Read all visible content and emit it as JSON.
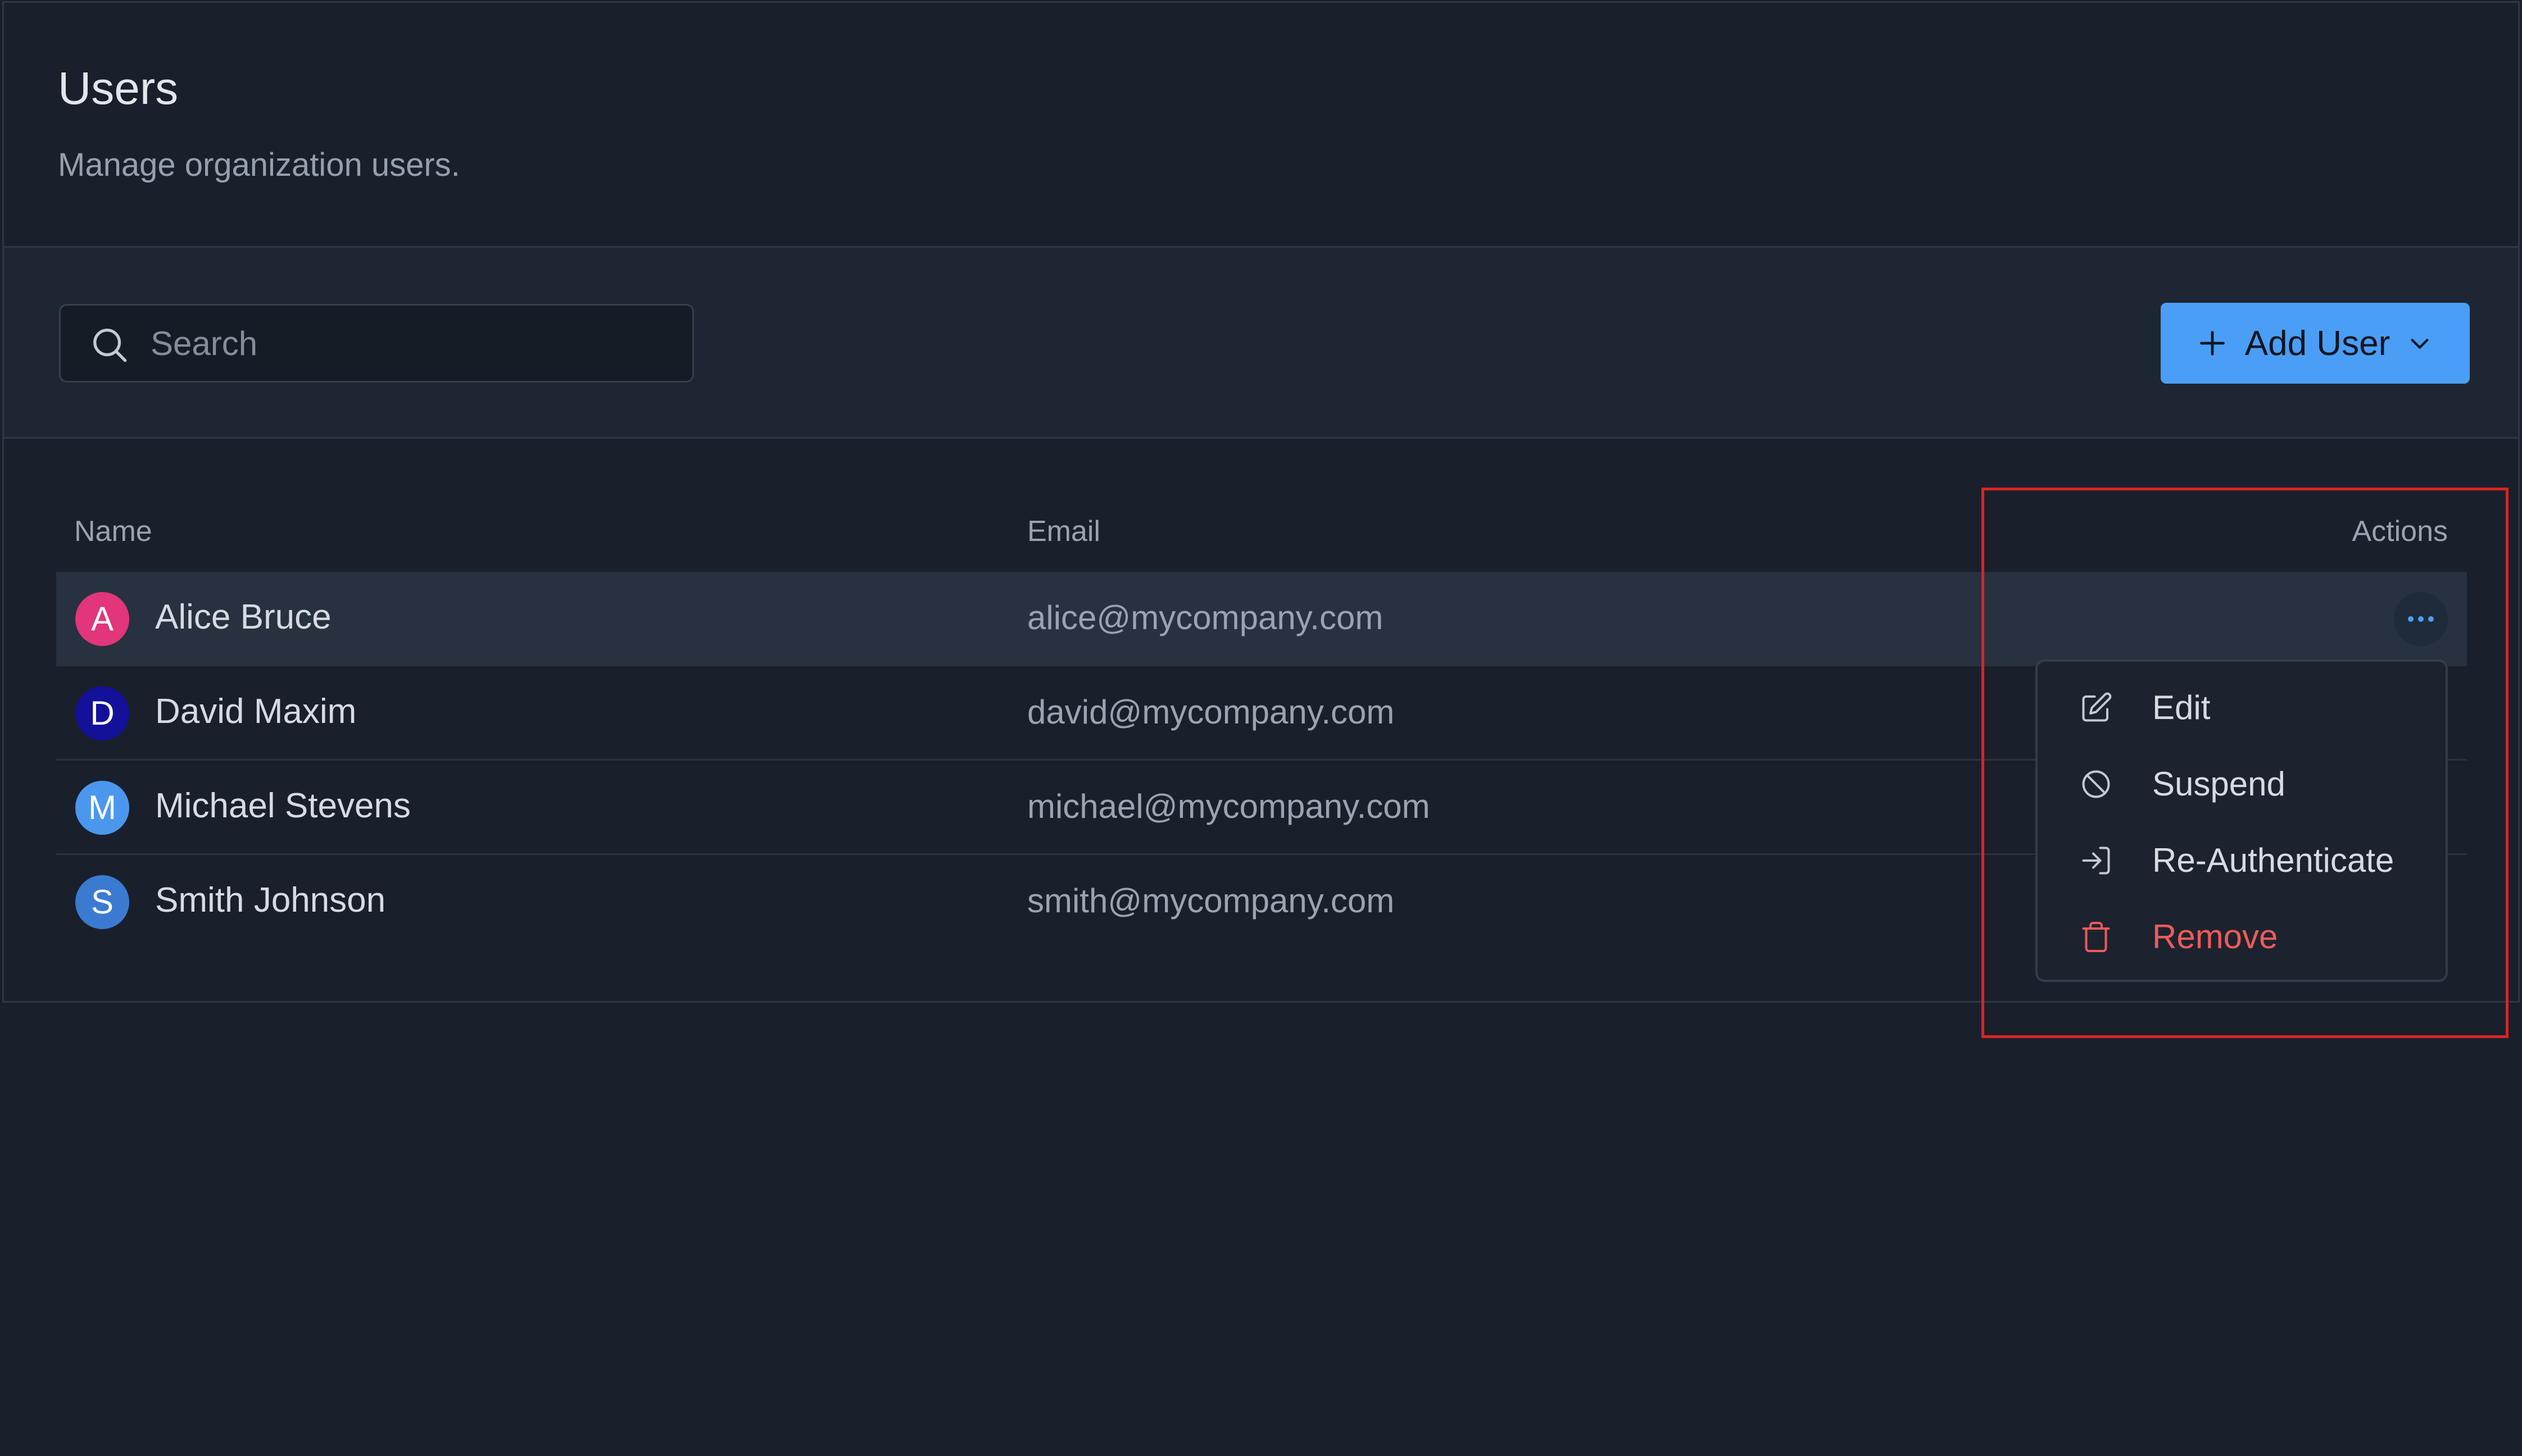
{
  "page": {
    "title": "Users",
    "subtitle": "Manage organization users."
  },
  "toolbar": {
    "search_placeholder": "Search",
    "search_value": "",
    "add_user_label": "Add User"
  },
  "table": {
    "columns": {
      "name": "Name",
      "email": "Email",
      "actions": "Actions"
    },
    "rows": [
      {
        "initial": "A",
        "name": "Alice Bruce",
        "email": "alice@mycompany.com",
        "avatar_color": "#e2357a",
        "selected": true
      },
      {
        "initial": "D",
        "name": "David Maxim",
        "email": "david@mycompany.com",
        "avatar_color": "#13109a",
        "selected": false
      },
      {
        "initial": "M",
        "name": "Michael Stevens",
        "email": "michael@mycompany.com",
        "avatar_color": "#4c97ee",
        "selected": false
      },
      {
        "initial": "S",
        "name": "Smith Johnson",
        "email": "smith@mycompany.com",
        "avatar_color": "#3a7bd1",
        "selected": false
      }
    ]
  },
  "actions_menu": {
    "items": [
      {
        "label": "Edit",
        "icon": "pencil-square-icon"
      },
      {
        "label": "Suspend",
        "icon": "ban-icon"
      },
      {
        "label": "Re-Authenticate",
        "icon": "login-arrow-icon"
      },
      {
        "label": "Remove",
        "icon": "trash-icon",
        "danger": true
      }
    ]
  },
  "colors": {
    "background": "#19202b",
    "toolbar_background": "#1e2633",
    "accent": "#4a9ef5",
    "danger": "#ef5a5a",
    "highlight": "#d92424"
  }
}
